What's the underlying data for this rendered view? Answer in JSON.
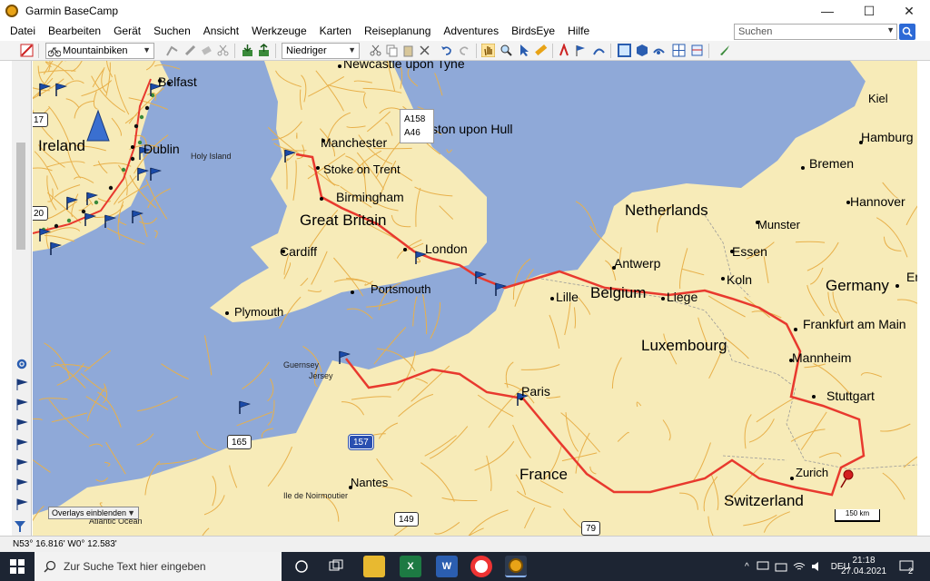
{
  "window": {
    "title": "Garmin BaseCamp",
    "minimize": "—",
    "maximize": "☐",
    "close": "✕"
  },
  "menu": [
    "Datei",
    "Bearbeiten",
    "Gerät",
    "Suchen",
    "Ansicht",
    "Werkzeuge",
    "Karten",
    "Reiseplanung",
    "Adventures",
    "BirdsEye",
    "Hilfe"
  ],
  "search": {
    "placeholder": "Suchen"
  },
  "toolbar": {
    "profile": "Mountainbiken",
    "detail_level": "Niedriger"
  },
  "map": {
    "countries": [
      {
        "name": "Ireland"
      },
      {
        "name": "Great Britain"
      },
      {
        "name": "Netherlands"
      },
      {
        "name": "Belgium"
      },
      {
        "name": "Luxembourg"
      },
      {
        "name": "Germany"
      },
      {
        "name": "France"
      },
      {
        "name": "Switzerland"
      }
    ],
    "cities": [
      "Newcastle upon Tyne",
      "Belfast",
      "Dublin",
      "Manchester",
      "Kingston upon Hull",
      "Stoke on Trent",
      "Birmingham",
      "Cardiff",
      "London",
      "Portsmouth",
      "Plymouth",
      "Lille",
      "Antwerp",
      "Liege",
      "Essen",
      "Koln",
      "Munster",
      "Kiel",
      "Hamburg",
      "Bremen",
      "Hannover",
      "Frankfurt am Main",
      "Mannheim",
      "Stuttgart",
      "Paris",
      "Nantes",
      "Zurich",
      "Er"
    ],
    "small_labels": [
      "Holy Island",
      "Guernsey",
      "Jersey",
      "Ile de Noirmoutier",
      "Atlantic Ocean"
    ],
    "road_shields": [
      "165",
      "157",
      "149",
      "79",
      "20",
      "17"
    ],
    "tooltip": [
      "A158",
      "A46"
    ],
    "overlay_button": "Overlays einblenden",
    "scale": "150 km"
  },
  "status": {
    "coords": "N53° 16.816' W0° 12.583'"
  },
  "taskbar": {
    "search_placeholder": "Zur Suche Text hier eingeben",
    "language": "DEU",
    "time": "21:18",
    "date": "27.04.2021",
    "notifications": "2"
  },
  "colors": {
    "route": "#e8392e",
    "land": "#f7ebb8",
    "sea": "#8fa9d8",
    "road": "#e8b04a"
  }
}
